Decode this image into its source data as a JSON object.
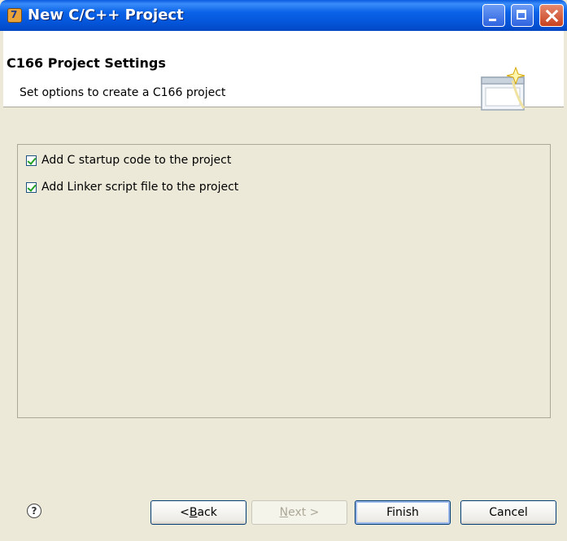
{
  "window": {
    "title": "New C/C++ Project"
  },
  "header": {
    "title": "C166 Project Settings",
    "description": "Set options to create a C166 project"
  },
  "options": [
    {
      "label": "Add C startup code to the project",
      "checked": true
    },
    {
      "label": "Add Linker script file to the project",
      "checked": true
    }
  ],
  "buttons": {
    "help": "?",
    "back_mnemonic": "B",
    "back_rest": "ack",
    "back_prefix": "< ",
    "next_mnemonic": "N",
    "next_rest": "ext >",
    "finish": "Finish",
    "cancel": "Cancel"
  },
  "icons": {
    "app": "eclipse-app-icon",
    "wizard": "new-project-wizard-icon",
    "help": "help-icon"
  }
}
